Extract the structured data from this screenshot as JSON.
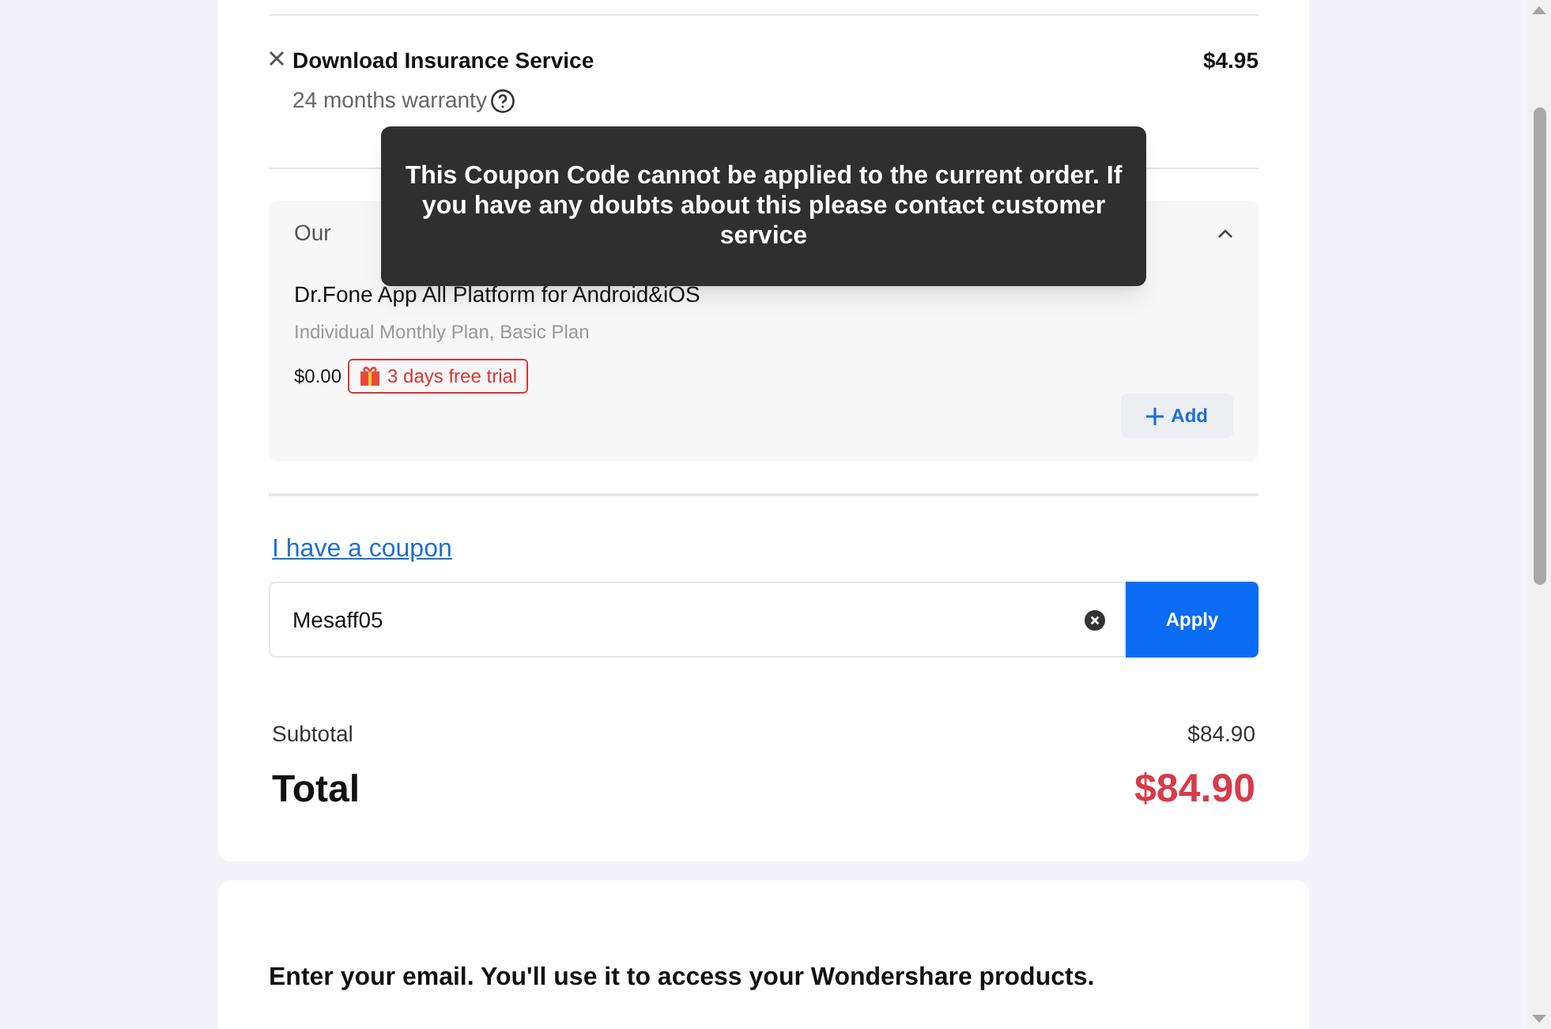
{
  "insurance": {
    "title": "Download Insurance Service",
    "subtitle": "24 months warranty",
    "price": "$4.95"
  },
  "tooltip": {
    "text": "This Coupon Code cannot be applied to the current order. If you have any doubts about this please contact customer service"
  },
  "upsell": {
    "heading": "Our",
    "expanded": true,
    "product": "Dr.Fone App All Platform for Android&iOS",
    "plan": "Individual Monthly Plan, Basic Plan",
    "price": "$0.00",
    "badge": "3 days free trial",
    "add_label": "Add"
  },
  "coupon": {
    "link": "I have a coupon",
    "value": "Mesaff05",
    "apply": "Apply"
  },
  "summary": {
    "subtotal_label": "Subtotal",
    "subtotal": "$84.90",
    "total_label": "Total",
    "total": "$84.90"
  },
  "email_section": {
    "heading": "Enter your email. You'll use it to access your Wondershare products."
  }
}
